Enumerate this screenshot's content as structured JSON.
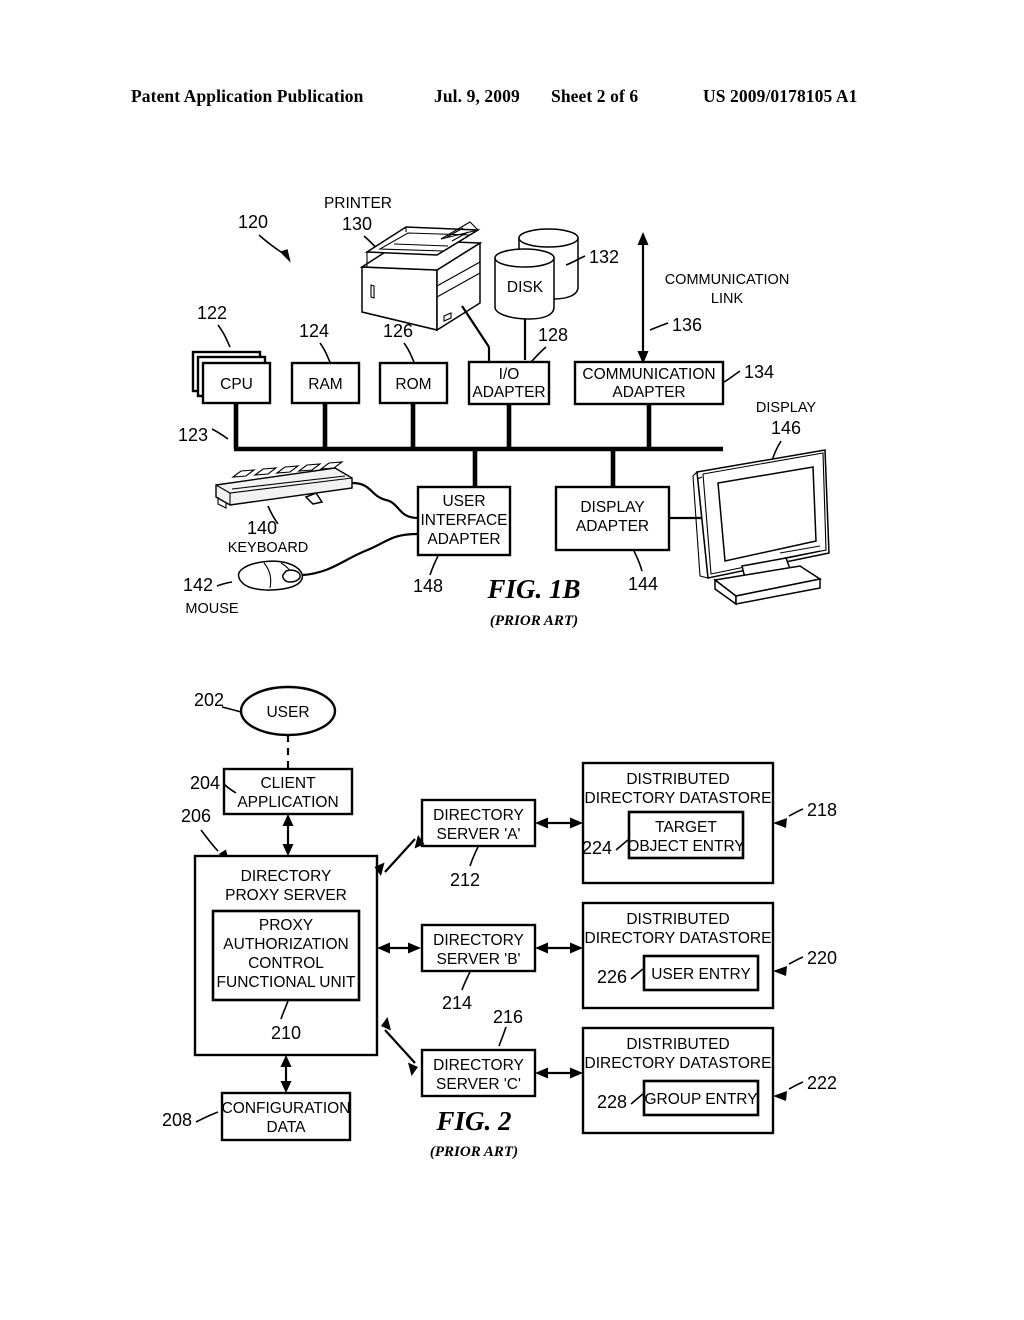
{
  "header": {
    "title": "Patent Application Publication",
    "date": "Jul. 9, 2009",
    "sheet": "Sheet 2 of 6",
    "number": "US 2009/0178105 A1"
  },
  "fig1b": {
    "caption": "FIG. 1B",
    "caption_sub": "(PRIOR ART)",
    "refs": {
      "system": "120",
      "cpu": "122",
      "bus": "123",
      "ram": "124",
      "rom": "126",
      "io_adapter": "128",
      "printer": "130",
      "disk": "132",
      "comm_adapter": "134",
      "comm_link": "136",
      "keyboard": "140",
      "mouse": "142",
      "display_adapter": "144",
      "display": "146",
      "ui_adapter": "148"
    },
    "labels": {
      "printer": "PRINTER",
      "disk": "DISK",
      "comm_link_l1": "COMMUNICATION",
      "comm_link_l2": "LINK",
      "display": "DISPLAY",
      "keyboard": "KEYBOARD",
      "mouse": "MOUSE"
    },
    "boxes": {
      "cpu": "CPU",
      "ram": "RAM",
      "rom": "ROM",
      "io_l1": "I/O",
      "io_l2": "ADAPTER",
      "comm_l1": "COMMUNICATION",
      "comm_l2": "ADAPTER",
      "ui_l1": "USER",
      "ui_l2": "INTERFACE",
      "ui_l3": "ADAPTER",
      "disp_l1": "DISPLAY",
      "disp_l2": "ADAPTER"
    }
  },
  "fig2": {
    "caption": "FIG. 2",
    "caption_sub": "(PRIOR ART)",
    "refs": {
      "user": "202",
      "client_application": "204",
      "directory_proxy_server": "206",
      "configuration_data": "208",
      "proxy_auth_unit": "210",
      "directory_server_a": "212",
      "directory_server_b": "214",
      "directory_server_c": "216",
      "datastore_a": "218",
      "datastore_b": "220",
      "datastore_c": "222",
      "target_object_entry": "224",
      "user_entry": "226",
      "group_entry": "228"
    },
    "boxes": {
      "user": "USER",
      "client_l1": "CLIENT",
      "client_l2": "APPLICATION",
      "dps_l1": "DIRECTORY",
      "dps_l2": "PROXY SERVER",
      "pacfu_l1": "PROXY",
      "pacfu_l2": "AUTHORIZATION",
      "pacfu_l3": "CONTROL",
      "pacfu_l4": "FUNCTIONAL UNIT",
      "config_l1": "CONFIGURATION",
      "config_l2": "DATA",
      "ds_l1": "DIRECTORY",
      "ds_a_l2": "SERVER 'A'",
      "ds_b_l2": "SERVER 'B'",
      "ds_c_l2": "SERVER 'C'",
      "datastore_l1": "DISTRIBUTED",
      "datastore_l2": "DIRECTORY DATASTORE",
      "target_l1": "TARGET",
      "target_l2": "OBJECT ENTRY",
      "user_entry": "USER ENTRY",
      "group_entry": "GROUP ENTRY"
    }
  }
}
